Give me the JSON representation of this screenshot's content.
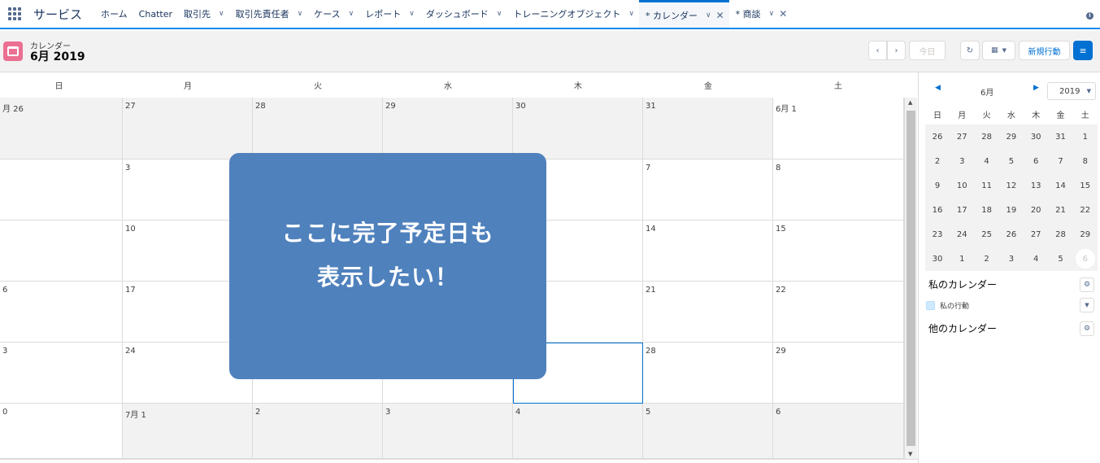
{
  "app": {
    "name": "サービス"
  },
  "nav": {
    "tabs": [
      {
        "label": "ホーム",
        "chevron": false
      },
      {
        "label": "Chatter",
        "chevron": false
      },
      {
        "label": "取引先",
        "chevron": true
      },
      {
        "label": "取引先責任者",
        "chevron": true
      },
      {
        "label": "ケース",
        "chevron": true
      },
      {
        "label": "レポート",
        "chevron": true
      },
      {
        "label": "ダッシュボード",
        "chevron": true
      },
      {
        "label": "トレーニングオブジェクト",
        "chevron": true
      },
      {
        "label": "* カレンダー",
        "chevron": true,
        "closable": true,
        "active": true
      },
      {
        "label": "* 商談",
        "chevron": true,
        "closable": true
      }
    ]
  },
  "header": {
    "object_label": "カレンダー",
    "title": "6月 2019",
    "today_label": "今日",
    "new_event_label": "新規行動"
  },
  "weekdays": [
    "日",
    "月",
    "火",
    "水",
    "木",
    "金",
    "土"
  ],
  "weeks": [
    [
      {
        "d": "月 26",
        "out": true
      },
      {
        "d": "27",
        "out": true
      },
      {
        "d": "28",
        "out": true
      },
      {
        "d": "29",
        "out": true
      },
      {
        "d": "30",
        "out": true
      },
      {
        "d": "31",
        "out": true
      },
      {
        "d": "6月 1",
        "out": false
      }
    ],
    [
      {
        "d": "",
        "out": false
      },
      {
        "d": "3",
        "out": false
      },
      {
        "d": "",
        "out": false
      },
      {
        "d": "",
        "out": false
      },
      {
        "d": "",
        "out": false
      },
      {
        "d": "7",
        "out": false
      },
      {
        "d": "8",
        "out": false
      }
    ],
    [
      {
        "d": "",
        "out": false
      },
      {
        "d": "10",
        "out": false
      },
      {
        "d": "",
        "out": false
      },
      {
        "d": "",
        "out": false
      },
      {
        "d": "",
        "out": false
      },
      {
        "d": "14",
        "out": false
      },
      {
        "d": "15",
        "out": false
      }
    ],
    [
      {
        "d": "6",
        "out": false
      },
      {
        "d": "17",
        "out": false
      },
      {
        "d": "",
        "out": false
      },
      {
        "d": "",
        "out": false
      },
      {
        "d": "",
        "out": false
      },
      {
        "d": "21",
        "out": false
      },
      {
        "d": "22",
        "out": false
      }
    ],
    [
      {
        "d": "3",
        "out": false
      },
      {
        "d": "24",
        "out": false
      },
      {
        "d": "",
        "out": false
      },
      {
        "d": "",
        "out": false
      },
      {
        "d": "",
        "out": false,
        "selected": true
      },
      {
        "d": "28",
        "out": false
      },
      {
        "d": "29",
        "out": false
      }
    ],
    [
      {
        "d": "0",
        "out": false
      },
      {
        "d": "7月 1",
        "out": true
      },
      {
        "d": "2",
        "out": true
      },
      {
        "d": "3",
        "out": true
      },
      {
        "d": "4",
        "out": true
      },
      {
        "d": "5",
        "out": true
      },
      {
        "d": "6",
        "out": true
      }
    ]
  ],
  "overlay": {
    "line1": "ここに完了予定日も",
    "line2": "表示したい！"
  },
  "sidebar": {
    "mini_month": "6月",
    "year": "2019",
    "weekdays": [
      "日",
      "月",
      "火",
      "水",
      "木",
      "金",
      "土"
    ],
    "days": [
      [
        "26",
        "27",
        "28",
        "29",
        "30",
        "31",
        "1"
      ],
      [
        "2",
        "3",
        "4",
        "5",
        "6",
        "7",
        "8"
      ],
      [
        "9",
        "10",
        "11",
        "12",
        "13",
        "14",
        "15"
      ],
      [
        "16",
        "17",
        "18",
        "19",
        "20",
        "21",
        "22"
      ],
      [
        "23",
        "24",
        "25",
        "26",
        "27",
        "28",
        "29"
      ],
      [
        "30",
        "1",
        "2",
        "3",
        "4",
        "5",
        "6"
      ]
    ],
    "today_index": [
      5,
      6
    ],
    "my_calendars_label": "私のカレンダー",
    "my_calendar_item": "私の行動",
    "other_calendars_label": "他のカレンダー"
  }
}
